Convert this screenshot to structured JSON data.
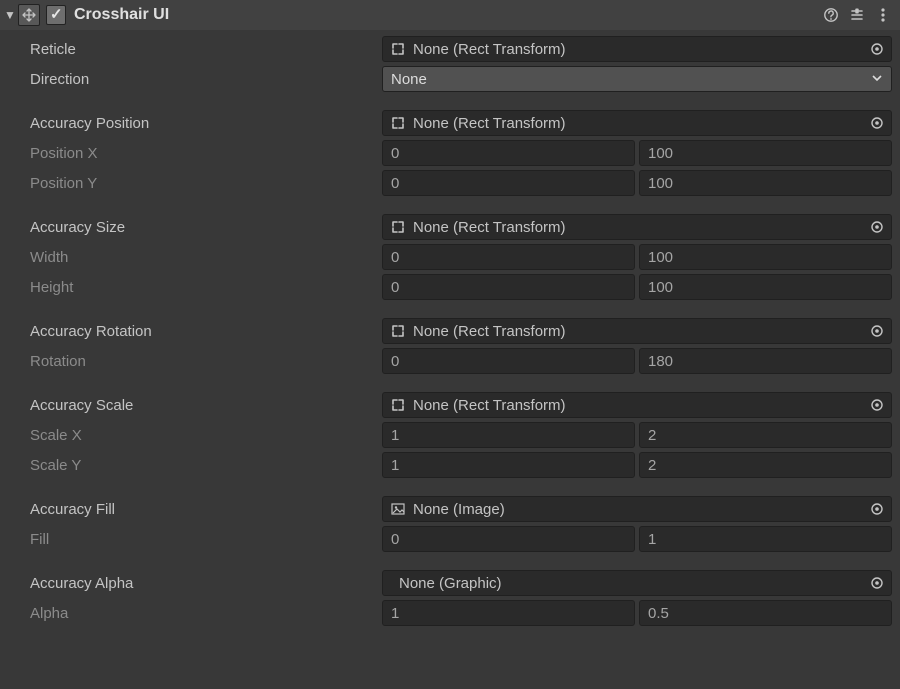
{
  "component": {
    "enabled": true,
    "title": "Crosshair UI"
  },
  "fields": {
    "reticle": {
      "label": "Reticle",
      "object": "None (Rect Transform)"
    },
    "direction": {
      "label": "Direction",
      "value": "None"
    },
    "accuracyPosition": {
      "label": "Accuracy Position",
      "object": "None (Rect Transform)"
    },
    "positionX": {
      "label": "Position X",
      "a": "0",
      "b": "100"
    },
    "positionY": {
      "label": "Position Y",
      "a": "0",
      "b": "100"
    },
    "accuracySize": {
      "label": "Accuracy Size",
      "object": "None (Rect Transform)"
    },
    "width": {
      "label": "Width",
      "a": "0",
      "b": "100"
    },
    "height": {
      "label": "Height",
      "a": "0",
      "b": "100"
    },
    "accuracyRotation": {
      "label": "Accuracy Rotation",
      "object": "None (Rect Transform)"
    },
    "rotation": {
      "label": "Rotation",
      "a": "0",
      "b": "180"
    },
    "accuracyScale": {
      "label": "Accuracy Scale",
      "object": "None (Rect Transform)"
    },
    "scaleX": {
      "label": "Scale X",
      "a": "1",
      "b": "2"
    },
    "scaleY": {
      "label": "Scale Y",
      "a": "1",
      "b": "2"
    },
    "accuracyFill": {
      "label": "Accuracy Fill",
      "object": "None (Image)"
    },
    "fill": {
      "label": "Fill",
      "a": "0",
      "b": "1"
    },
    "accuracyAlpha": {
      "label": "Accuracy Alpha",
      "object": "None (Graphic)"
    },
    "alpha": {
      "label": "Alpha",
      "a": "1",
      "b": "0.5"
    }
  }
}
